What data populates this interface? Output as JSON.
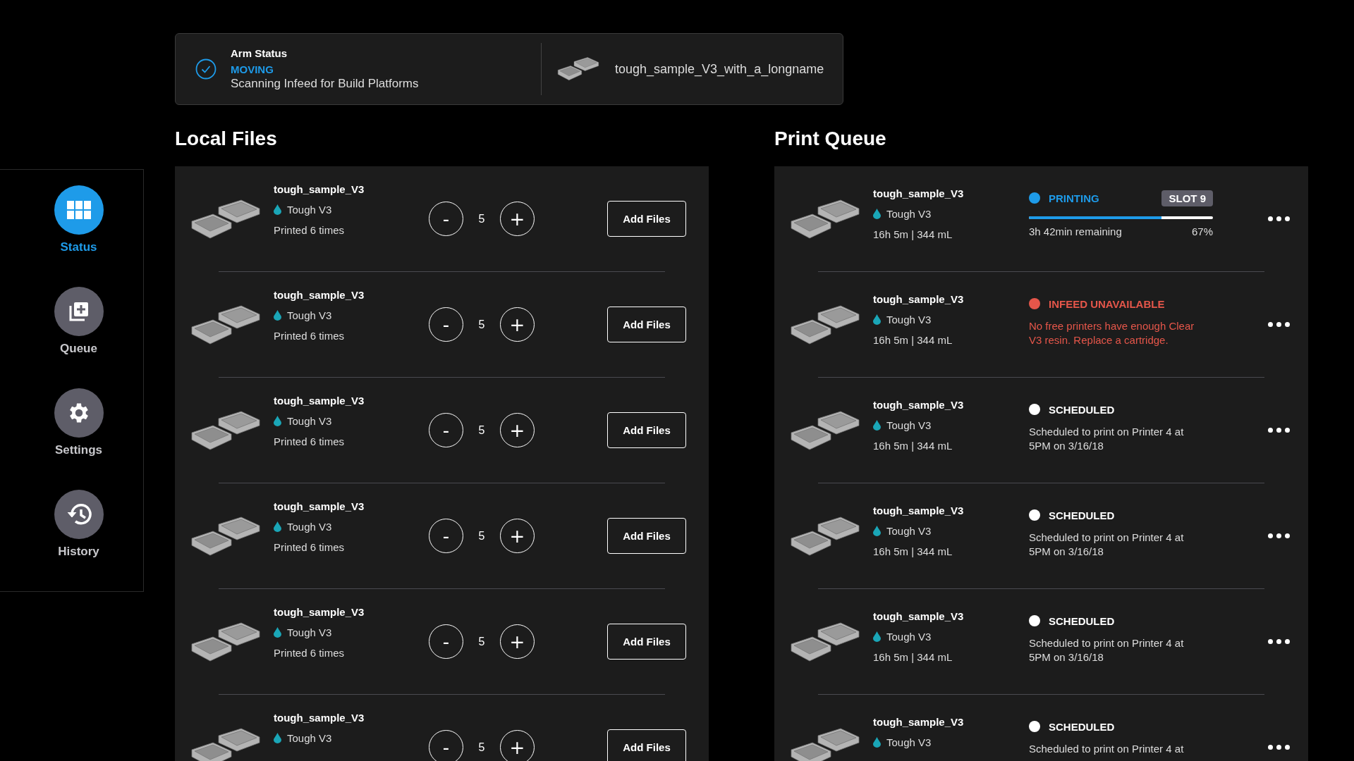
{
  "arm_status": {
    "title": "Arm Status",
    "state": "MOVING",
    "detail": "Scanning Infeed for Build Platforms",
    "file": "tough_sample_V3_with_a_longname"
  },
  "sidebar": {
    "items": [
      {
        "label": "Status",
        "kind": "status",
        "selected": true
      },
      {
        "label": "Queue",
        "kind": "queue",
        "selected": false
      },
      {
        "label": "Settings",
        "kind": "settings",
        "selected": false
      },
      {
        "label": "History",
        "kind": "history",
        "selected": false
      }
    ]
  },
  "local_files": {
    "title": "Local Files",
    "rows": [
      {
        "name": "tough_sample_V3",
        "material": "Tough V3",
        "printed": "Printed 6 times",
        "quantity": "5",
        "minus": "-",
        "plus": "+",
        "button": "Add Files"
      },
      {
        "name": "tough_sample_V3",
        "material": "Tough V3",
        "printed": "Printed 6 times",
        "quantity": "5",
        "minus": "-",
        "plus": "+",
        "button": "Add Files"
      },
      {
        "name": "tough_sample_V3",
        "material": "Tough V3",
        "printed": "Printed 6 times",
        "quantity": "5",
        "minus": "-",
        "plus": "+",
        "button": "Add Files"
      },
      {
        "name": "tough_sample_V3",
        "material": "Tough V3",
        "printed": "Printed 6 times",
        "quantity": "5",
        "minus": "-",
        "plus": "+",
        "button": "Add Files"
      },
      {
        "name": "tough_sample_V3",
        "material": "Tough V3",
        "printed": "Printed 6 times",
        "quantity": "5",
        "minus": "-",
        "plus": "+",
        "button": "Add Files"
      },
      {
        "name": "tough_sample_V3",
        "material": "Tough V3",
        "quantity": "5",
        "minus": "-",
        "plus": "+",
        "button": "Add Files"
      }
    ]
  },
  "print_queue": {
    "title": "Print Queue",
    "rows": [
      {
        "kind": "printing",
        "name": "tough_sample_V3",
        "material": "Tough V3",
        "stats": "16h 5m | 344 mL",
        "status": "PRINTING",
        "slot": "SLOT 9",
        "level": 0.72,
        "remaining": "3h 42min remaining",
        "percent": "67%"
      },
      {
        "kind": "error",
        "name": "tough_sample_V3",
        "material": "Tough V3",
        "stats": "16h 5m | 344 mL",
        "status": "INFEED UNAVAILABLE",
        "message": "No free printers have enough Clear V3 resin. Replace a cartridge."
      },
      {
        "kind": "scheduled",
        "name": "tough_sample_V3",
        "material": "Tough V3",
        "stats": "16h 5m | 344 mL",
        "status": "SCHEDULED",
        "message": "Scheduled to print on Printer 4 at 5PM on 3/16/18"
      },
      {
        "kind": "scheduled",
        "name": "tough_sample_V3",
        "material": "Tough V3",
        "stats": "16h 5m | 344 mL",
        "status": "SCHEDULED",
        "message": "Scheduled to print on Printer 4 at 5PM on 3/16/18"
      },
      {
        "kind": "scheduled",
        "name": "tough_sample_V3",
        "material": "Tough V3",
        "stats": "16h 5m | 344 mL",
        "status": "SCHEDULED",
        "message": "Scheduled to print on Printer 4 at 5PM on 3/16/18"
      },
      {
        "kind": "scheduled",
        "name": "tough_sample_V3",
        "material": "Tough V3",
        "status": "SCHEDULED",
        "message": "Scheduled to print on Printer 4 at"
      }
    ]
  }
}
